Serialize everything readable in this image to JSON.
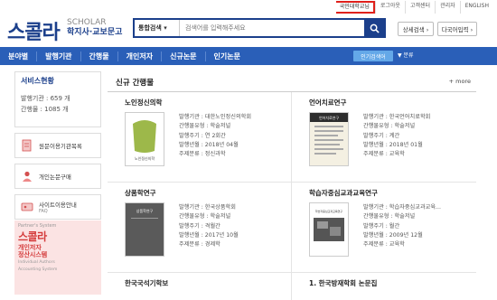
{
  "topbar": {
    "links": [
      "국민대학교님",
      "로그아웃",
      "고객센터",
      "관리자",
      "ENGLISH"
    ]
  },
  "header": {
    "logo": "스콜라",
    "logo_en": "SCHOLAR",
    "logo_sub": "학지사·교보문고",
    "search_scope": "통합검색 ▾",
    "search_placeholder": "검색어를 입력해주세요",
    "advanced_search": "상세검색 ›",
    "multi_search": "다국어입력 ›"
  },
  "nav": {
    "items": [
      "분야별",
      "발행기관",
      "간행물",
      "개인저자",
      "신규논문",
      "인기논문"
    ],
    "hot_search": "인기검색어",
    "hot_more": "▼ 분류"
  },
  "sidebar": {
    "service_title": "서비스현황",
    "publishers": "발행기관 : 659 개",
    "journals": "간행물 : 1085 개",
    "links": [
      {
        "label": "원문이용기관목록",
        "sub": ""
      },
      {
        "label": "개인논문구매",
        "sub": ""
      },
      {
        "label": "사이트이용안내",
        "sub": "FAQ"
      }
    ],
    "partner": {
      "line1": "Partner's System",
      "title": "스콜라",
      "subtitle1": "개인저자",
      "subtitle2": "정산시스템",
      "en1": "Individual Authors",
      "en2": "Accounting System"
    }
  },
  "main": {
    "title": "신규 간행물",
    "more": "+ more",
    "cards": [
      {
        "name": "노인정신의학",
        "cover_text": "노인정신의학",
        "rows": [
          "발행기관 : 대한노인정신의학회",
          "간행물유형 : 학술저널",
          "발행주기 : 연 2회간",
          "발행년월 : 2018년 04월",
          "주제분류 : 정신과학"
        ]
      },
      {
        "name": "언어치료연구",
        "cover_text": "언어치료연구",
        "rows": [
          "발행기관 : 한국언어치료학회",
          "간행물유형 : 학술저널",
          "발행주기 : 계간",
          "발행년월 : 2018년 01월",
          "주제분류 : 교육학"
        ]
      },
      {
        "name": "상품학연구",
        "cover_text": "상품학연구",
        "rows": [
          "발행기관 : 한국상품학회",
          "간행물유형 : 학술저널",
          "발행주기 : 격월간",
          "발행년월 : 2017년 10월",
          "주제분류 : 경제학"
        ]
      },
      {
        "name": "학습자중심교과교육연구",
        "cover_text": "학습자중심교과교육연구",
        "rows": [
          "발행기관 : 학습자중심교과교육...",
          "간행물유형 : 학술저널",
          "발행주기 : 월간",
          "발행년월 : 2009년 12월",
          "주제분류 : 교육학"
        ]
      },
      {
        "name": "한국국석기학보",
        "cover_text": "",
        "rows": []
      },
      {
        "name": "1. 한국방재학회 논문집",
        "cover_text": "",
        "rows": []
      }
    ]
  }
}
